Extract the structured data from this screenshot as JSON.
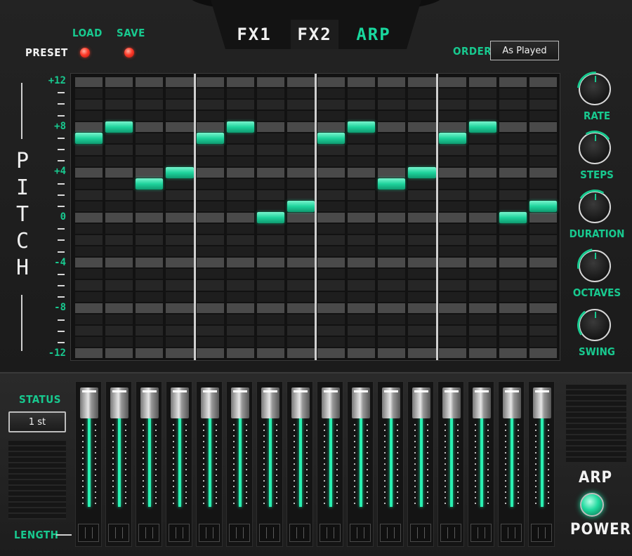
{
  "tabs": [
    {
      "label": "FX1",
      "active": false
    },
    {
      "label": "FX2",
      "active": false
    },
    {
      "label": "ARP",
      "active": true
    }
  ],
  "preset": {
    "label": "PRESET",
    "load_label": "LOAD",
    "save_label": "SAVE"
  },
  "order": {
    "label": "ORDER",
    "value": "As Played"
  },
  "pitch": {
    "label": "PITCH",
    "letters": [
      "P",
      "I",
      "T",
      "C",
      "H"
    ],
    "tick_labels": [
      "+12",
      "+8",
      "+4",
      "0",
      "-4",
      "-8",
      "-12"
    ]
  },
  "grid": {
    "steps": 16,
    "pitch_range": [
      -12,
      12
    ],
    "notes": [
      7,
      8,
      3,
      4,
      7,
      8,
      0,
      1,
      7,
      8,
      3,
      4,
      7,
      8,
      0,
      1
    ]
  },
  "knobs": [
    {
      "label": "RATE",
      "value": 0.35
    },
    {
      "label": "STEPS",
      "value": 0.55
    },
    {
      "label": "DURATION",
      "value": 0.45
    },
    {
      "label": "OCTAVES",
      "value": 0.3
    },
    {
      "label": "SWING",
      "value": 0.2
    }
  ],
  "status": {
    "label": "STATUS",
    "value": "1 st"
  },
  "length": {
    "label": "LENGTH"
  },
  "faders": {
    "count": 16,
    "values": [
      1,
      1,
      1,
      1,
      1,
      1,
      1,
      1,
      1,
      1,
      1,
      1,
      1,
      1,
      1,
      1
    ]
  },
  "power": {
    "label_top": "ARP",
    "label_bottom": "POWER",
    "on": true
  },
  "colors": {
    "accent": "#18c98f",
    "note": "#1ed39c",
    "led": "#ff3b2a"
  }
}
